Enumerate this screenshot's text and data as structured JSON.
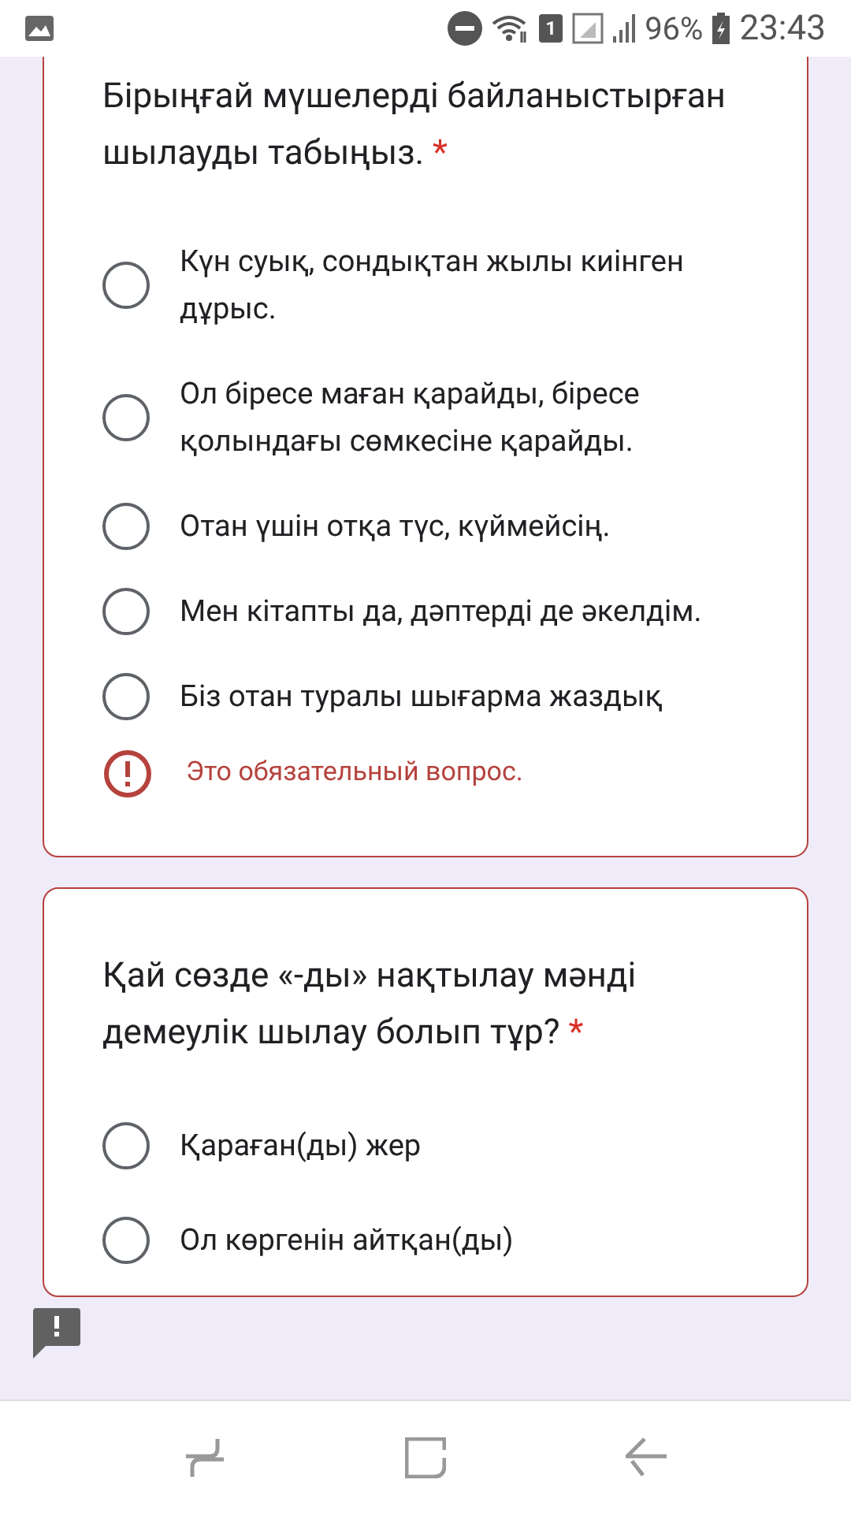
{
  "status_bar": {
    "sim_badge": "1",
    "battery": "96%",
    "time": "23:43"
  },
  "questions": [
    {
      "title": "Бірыңғай мүшелерді байланыстырған шылауды табыңыз.",
      "required_mark": "*",
      "options": [
        {
          "label": "Күн суық, сондықтан жылы киінген дұрыс.",
          "selected": false
        },
        {
          "label": "Ол біресе маған қарайды, біресе қолындағы сөмкесіне қарайды.",
          "selected": false
        },
        {
          "label": "Отан үшін отқа түс, күймейсің.",
          "selected": false
        },
        {
          "label": "Мен кітапты да, дәптерді де әкелдім.",
          "selected": false
        },
        {
          "label": "Біз отан туралы шығарма жаздық",
          "selected": false
        }
      ],
      "error": "Это обязательный вопрос."
    },
    {
      "title": "Қай сөзде «-ды» нақтылау мәнді демеулік шылау болып тұр?",
      "required_mark": "*",
      "options": [
        {
          "label": "Қараған(ды) жер",
          "selected": false
        },
        {
          "label": "Ол көргенін айтқан(ды)",
          "selected": false
        }
      ]
    }
  ]
}
